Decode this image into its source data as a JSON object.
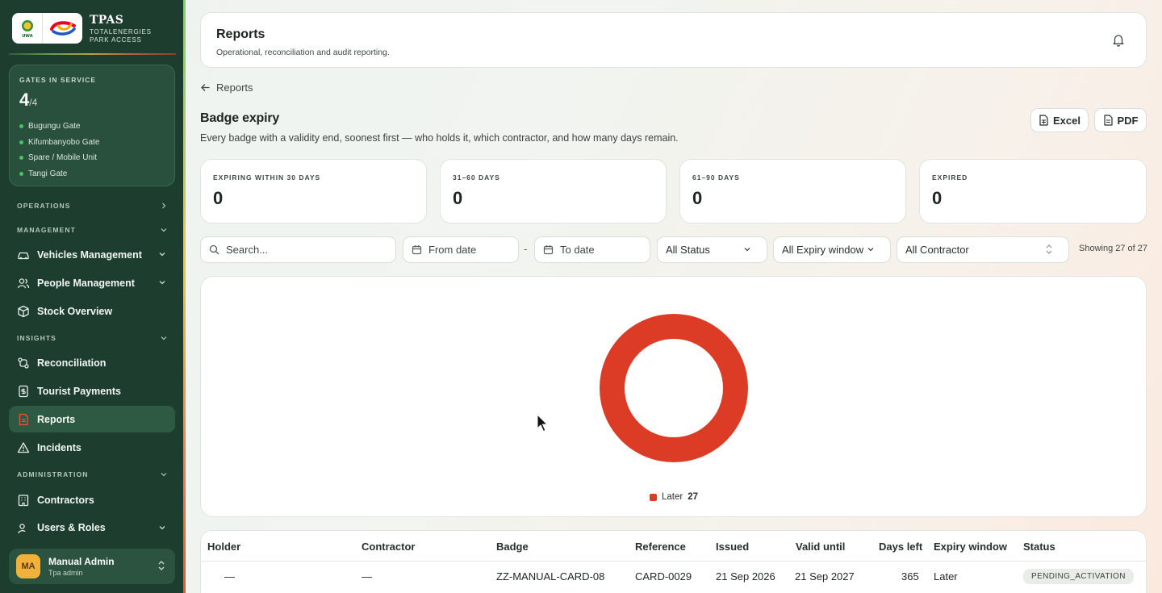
{
  "brand": {
    "title": "TPAS",
    "subtitle": "TOTALENERGIES PARK ACCESS",
    "logo_left_text": "UWA"
  },
  "gates": {
    "heading": "GATES IN SERVICE",
    "in_service": "4",
    "total": "/4",
    "list": [
      "Bugungu Gate",
      "Kifumbanyobo Gate",
      "Spare / Mobile Unit",
      "Tangi Gate"
    ]
  },
  "nav": {
    "sections": {
      "operations": "OPERATIONS",
      "management": "MANAGEMENT",
      "insights": "INSIGHTS",
      "administration": "ADMINISTRATION"
    },
    "items": {
      "vehicles": "Vehicles Management",
      "people": "People Management",
      "stock": "Stock Overview",
      "reconciliation": "Reconciliation",
      "tourist_payments": "Tourist Payments",
      "reports": "Reports",
      "incidents": "Incidents",
      "contractors": "Contractors",
      "users_roles": "Users & Roles"
    }
  },
  "user": {
    "initials": "MA",
    "name": "Manual Admin",
    "role": "Tpa admin"
  },
  "header": {
    "title": "Reports",
    "subtitle": "Operational, reconciliation and audit reporting."
  },
  "back": {
    "label": "Reports"
  },
  "report": {
    "title": "Badge expiry",
    "description": "Every badge with a validity end, soonest first — who holds it, which contractor, and how many days remain.",
    "export_excel": "Excel",
    "export_pdf": "PDF"
  },
  "stats": [
    {
      "label": "EXPIRING WITHIN 30 DAYS",
      "value": "0"
    },
    {
      "label": "31–60 DAYS",
      "value": "0"
    },
    {
      "label": "61–90 DAYS",
      "value": "0"
    },
    {
      "label": "EXPIRED",
      "value": "0"
    }
  ],
  "filters": {
    "search_placeholder": "Search...",
    "from_date": "From date",
    "date_separator": "-",
    "to_date": "To date",
    "status": "All Status",
    "expiry_window": "All Expiry window",
    "contractor": "All Contractor",
    "showing": "Showing 27 of 27"
  },
  "chart_data": {
    "type": "pie",
    "donut": true,
    "categories": [
      "Later"
    ],
    "values": [
      27
    ],
    "colors": [
      "#dc3c26"
    ],
    "legend": "bottom"
  },
  "table": {
    "columns": [
      "Holder",
      "Contractor",
      "Badge",
      "Reference",
      "Issued",
      "Valid until",
      "Days left",
      "Expiry window",
      "Status"
    ],
    "rows": [
      {
        "holder": "—",
        "contractor": "—",
        "badge": "ZZ-MANUAL-CARD-08",
        "reference": "CARD-0029",
        "issued": "21 Sep 2026",
        "valid_until": "21 Sep 2027",
        "days_left": "365",
        "expiry_window": "Later",
        "status": "PENDING_ACTIVATION"
      }
    ]
  },
  "colors": {
    "sidebar": "#1d3d2e",
    "accent": "#dc3c26",
    "active_nav": "#2e5a43"
  }
}
